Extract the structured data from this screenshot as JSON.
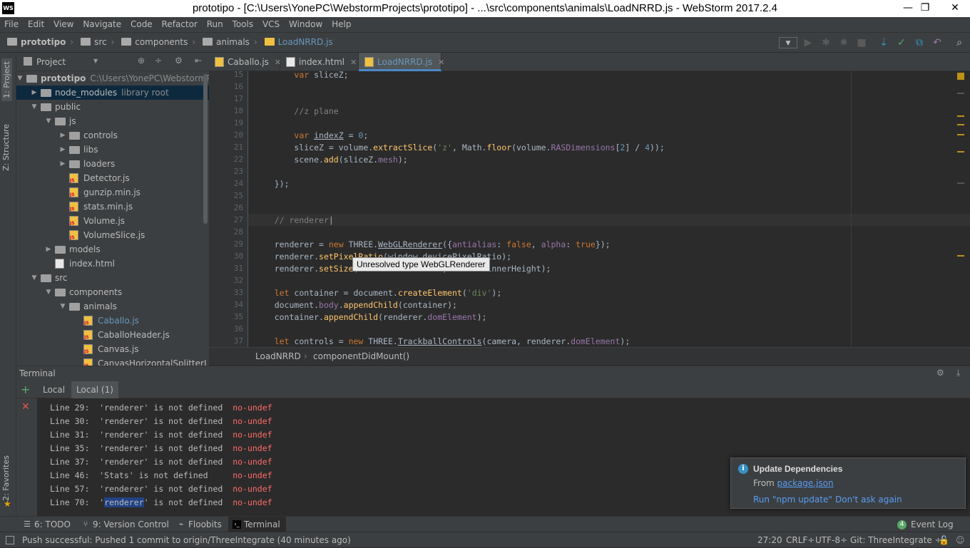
{
  "window": {
    "app_icon": "WS",
    "title": "prototipo - [C:\\Users\\YonePC\\WebstormProjects\\prototipo] - ...\\src\\components\\animals\\LoadNRRD.js - WebStorm 2017.2.4",
    "minimize": "—",
    "maximize": "❐",
    "close": "✕"
  },
  "menu": [
    "File",
    "Edit",
    "View",
    "Navigate",
    "Code",
    "Refactor",
    "Run",
    "Tools",
    "VCS",
    "Window",
    "Help"
  ],
  "breadcrumb": [
    "prototipo",
    "src",
    "components",
    "animals",
    "LoadNRRD.js"
  ],
  "left_tool_tabs": {
    "project": "1: Project",
    "structure": "Z: Structure",
    "favorites": "2: Favorites"
  },
  "project_panel": {
    "header": "Project",
    "tree": [
      {
        "label": "prototipo",
        "extra": "C:\\Users\\YonePC\\WebstormProjects\\",
        "kind": "folder",
        "depth": 0,
        "open": true,
        "bold": true
      },
      {
        "label": "node_modules",
        "extra": "library root",
        "kind": "folder",
        "depth": 1,
        "open": false,
        "selected": true
      },
      {
        "label": "public",
        "kind": "folder",
        "depth": 1,
        "open": true
      },
      {
        "label": "js",
        "kind": "folder",
        "depth": 2,
        "open": true
      },
      {
        "label": "controls",
        "kind": "folder",
        "depth": 3,
        "open": false
      },
      {
        "label": "libs",
        "kind": "folder",
        "depth": 3,
        "open": false
      },
      {
        "label": "loaders",
        "kind": "folder",
        "depth": 3,
        "open": false
      },
      {
        "label": "Detector.js",
        "kind": "js",
        "depth": 3
      },
      {
        "label": "gunzip.min.js",
        "kind": "js",
        "depth": 3
      },
      {
        "label": "stats.min.js",
        "kind": "js",
        "depth": 3
      },
      {
        "label": "Volume.js",
        "kind": "js",
        "depth": 3
      },
      {
        "label": "VolumeSlice.js",
        "kind": "js",
        "depth": 3
      },
      {
        "label": "models",
        "kind": "folder",
        "depth": 2,
        "open": false
      },
      {
        "label": "index.html",
        "kind": "html",
        "depth": 2
      },
      {
        "label": "src",
        "kind": "folder",
        "depth": 1,
        "open": true
      },
      {
        "label": "components",
        "kind": "folder",
        "depth": 2,
        "open": true
      },
      {
        "label": "animals",
        "kind": "folder",
        "depth": 3,
        "open": true
      },
      {
        "label": "Caballo.js",
        "kind": "js",
        "depth": 4,
        "highlight": true
      },
      {
        "label": "CaballoHeader.js",
        "kind": "js",
        "depth": 4
      },
      {
        "label": "Canvas.js",
        "kind": "js",
        "depth": 4
      },
      {
        "label": "CanvasHorizontalSplitterLayout.js",
        "kind": "js",
        "depth": 4
      }
    ]
  },
  "editor_tabs": [
    {
      "label": "Caballo.js",
      "active": false
    },
    {
      "label": "index.html",
      "active": false
    },
    {
      "label": "LoadNRRD.js",
      "active": true
    }
  ],
  "editor": {
    "line_numbers": [
      "15",
      "16",
      "17",
      "18",
      "19",
      "20",
      "21",
      "22",
      "23",
      "24",
      "25",
      "26",
      "27",
      "28",
      "29",
      "30",
      "31",
      "32",
      "33",
      "34",
      "35",
      "36",
      "37"
    ],
    "breadcrumb": [
      "LoadNRRD",
      "componentDidMount()"
    ],
    "tooltip": "Unresolved type WebGLRenderer"
  },
  "terminal": {
    "title": "Terminal",
    "tabs": [
      "Local",
      "Local (1)"
    ],
    "lines": [
      {
        "text": "Line 29:  'renderer' is not defined  ",
        "rule": "no-undef"
      },
      {
        "text": "Line 30:  'renderer' is not defined  ",
        "rule": "no-undef"
      },
      {
        "text": "Line 31:  'renderer' is not defined  ",
        "rule": "no-undef"
      },
      {
        "text": "Line 35:  'renderer' is not defined  ",
        "rule": "no-undef"
      },
      {
        "text": "Line 37:  'renderer' is not defined  ",
        "rule": "no-undef"
      },
      {
        "text": "Line 46:  'Stats' is not defined     ",
        "rule": "no-undef"
      },
      {
        "text": "Line 57:  'renderer' is not defined  ",
        "rule": "no-undef"
      },
      {
        "text": "Line 70:  '",
        "selected": "renderer",
        "text_after": "' is not defined  ",
        "rule": "no-undef"
      }
    ]
  },
  "notification": {
    "title": "Update Dependencies",
    "from_label": "From ",
    "from_link": "package.json",
    "action_1": "Run \"npm update\"",
    "action_2": "Don't ask again"
  },
  "bottom_tools": {
    "todo": "6: TODO",
    "vcs": "9: Version Control",
    "floobits": "Floobits",
    "terminal": "Terminal",
    "event_log_count": "4",
    "event_log": "Event Log"
  },
  "status": {
    "message": "Push successful: Pushed 1 commit to origin/ThreeIntegrate (40 minutes ago)",
    "position": "27:20",
    "line_sep": "CRLF÷",
    "encoding": "UTF-8÷",
    "git": "Git: ThreeIntegrate ÷"
  },
  "colors": {
    "accent": "#4a88c7",
    "keyword": "#cc7832",
    "string": "#6a8759",
    "error": "#ff6b68",
    "link": "#589df6"
  }
}
